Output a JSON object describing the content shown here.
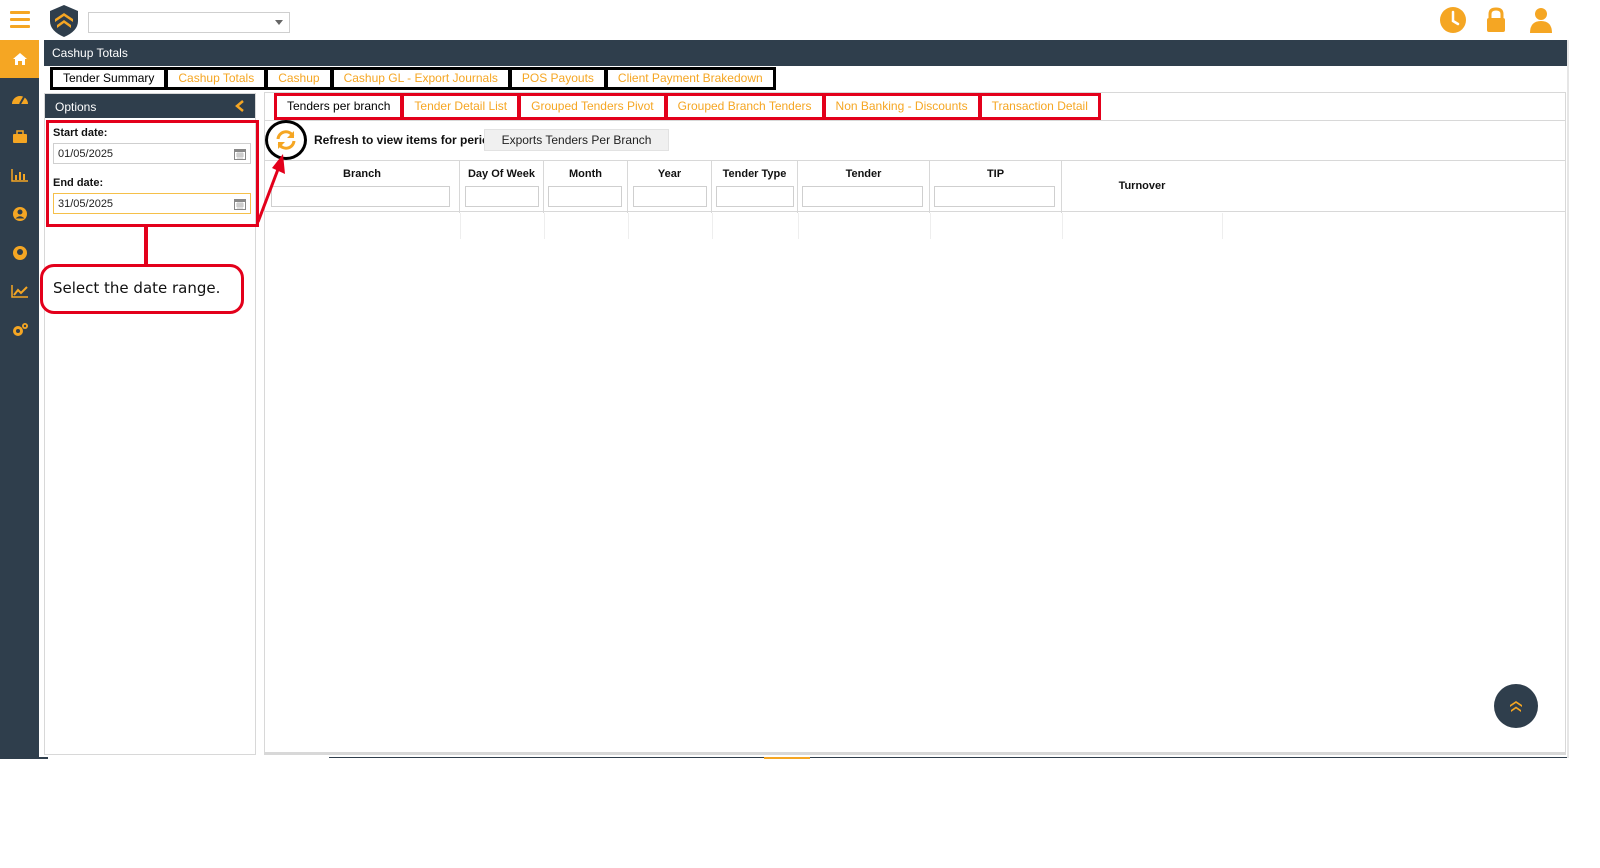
{
  "colors": {
    "accent": "#f5a623",
    "navy": "#2f3e4c",
    "annotation_red": "#e3001b"
  },
  "topbar": {
    "branch_select_value": "",
    "icons": [
      "menu-icon",
      "logo-icon",
      "clock-icon",
      "lock-icon",
      "user-icon"
    ]
  },
  "leftnav": {
    "items": [
      "home-icon",
      "dashboard-icon",
      "briefcase-icon",
      "bar-chart-icon",
      "user-circle-icon",
      "account-icon",
      "line-chart-icon",
      "settings-icon"
    ]
  },
  "page": {
    "title": "Cashup Totals"
  },
  "main_tabs": [
    {
      "label": "Tender Summary",
      "active": true
    },
    {
      "label": "Cashup Totals",
      "active": false
    },
    {
      "label": "Cashup",
      "active": false
    },
    {
      "label": "Cashup GL - Export Journals",
      "active": false
    },
    {
      "label": "POS Payouts",
      "active": false
    },
    {
      "label": "Client Payment Brakedown",
      "active": false
    }
  ],
  "options": {
    "title": "Options",
    "start_label": "Start date:",
    "start_value": "01/05/2025",
    "end_label": "End date:",
    "end_value": "31/05/2025"
  },
  "annotation": {
    "text": "Select the date range."
  },
  "sub_tabs": [
    {
      "label": "Tenders per branch",
      "active": true
    },
    {
      "label": "Tender Detail List",
      "active": false
    },
    {
      "label": "Grouped Tenders Pivot",
      "active": false
    },
    {
      "label": "Grouped Branch Tenders",
      "active": false
    },
    {
      "label": "Non Banking - Discounts",
      "active": false
    },
    {
      "label": "Transaction Detail",
      "active": false
    }
  ],
  "toolbar": {
    "refresh_text": "Refresh to view items for period",
    "export_label": "Exports Tenders Per Branch"
  },
  "grid": {
    "columns": [
      "Branch",
      "Day Of Week",
      "Month",
      "Year",
      "Tender Type",
      "Tender",
      "TIP",
      "Turnover"
    ]
  }
}
